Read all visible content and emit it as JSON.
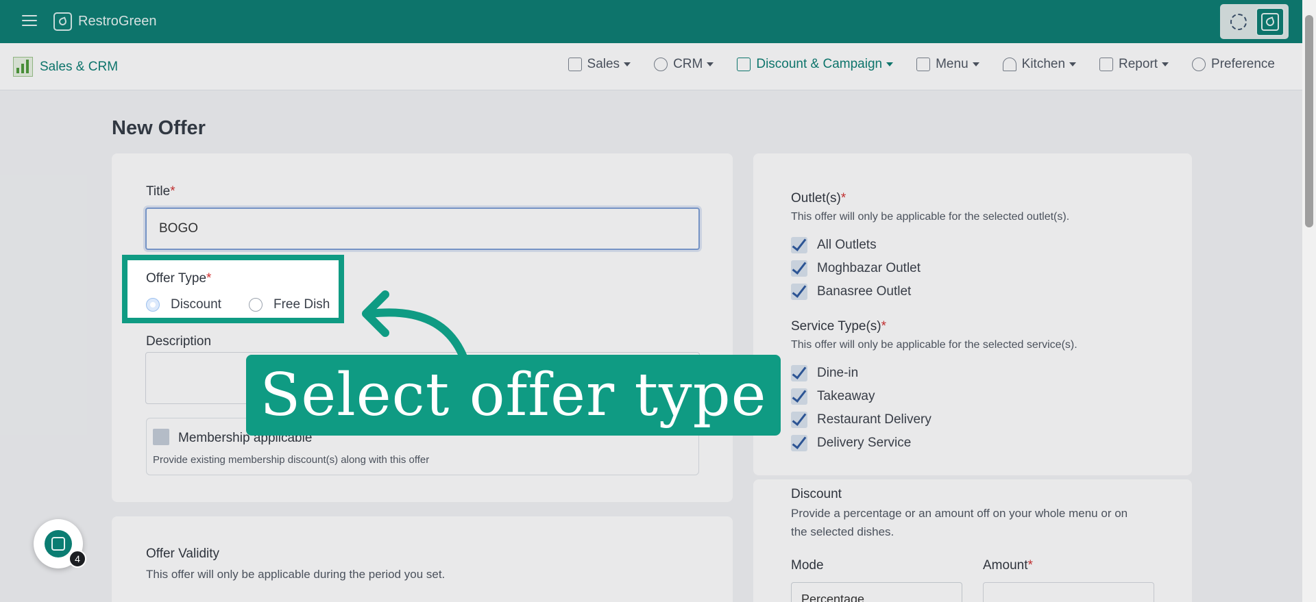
{
  "app": {
    "name": "RestroGreen"
  },
  "module": {
    "name": "Sales & CRM"
  },
  "nav": [
    {
      "label": "Sales",
      "icon": "register-icon",
      "active": false
    },
    {
      "label": "CRM",
      "icon": "users-icon",
      "active": false
    },
    {
      "label": "Discount & Campaign",
      "icon": "megaphone-icon",
      "active": true
    },
    {
      "label": "Menu",
      "icon": "menu-list-icon",
      "active": false
    },
    {
      "label": "Kitchen",
      "icon": "chef-icon",
      "active": false
    },
    {
      "label": "Report",
      "icon": "report-icon",
      "active": false
    },
    {
      "label": "Preference",
      "icon": "gear-icon",
      "active": false
    }
  ],
  "page": {
    "title": "New Offer"
  },
  "form": {
    "title_label": "Title",
    "required_mark": "*",
    "title_value": "BOGO",
    "offer_type_label": "Offer Type",
    "offer_types": [
      "Discount",
      "Free Dish"
    ],
    "selected_offer_type": "Discount",
    "description_label": "Description",
    "membership_label": "Membership applicable",
    "membership_help": "Provide existing membership discount(s) along with this offer",
    "validity_label": "Offer Validity",
    "validity_help": "This offer will only be applicable during the period you set."
  },
  "outlets": {
    "label": "Outlet(s)",
    "help": "This offer will only be applicable for the selected outlet(s).",
    "items": [
      "All Outlets",
      "Moghbazar Outlet",
      "Banasree Outlet"
    ]
  },
  "services": {
    "label": "Service Type(s)",
    "help": "This offer will only be applicable for the selected service(s).",
    "items": [
      "Dine-in",
      "Takeaway",
      "Restaurant Delivery",
      "Delivery Service"
    ]
  },
  "discount": {
    "label": "Discount",
    "help_line1": "Provide a percentage or an amount off on your whole menu or on",
    "help_line2": "the selected dishes.",
    "mode_label": "Mode",
    "mode_value": "Percentage",
    "amount_label": "Amount"
  },
  "tutorial": {
    "callout": "Select offer type"
  },
  "chat": {
    "badge": "4"
  },
  "colors": {
    "brand": "#0b7d72",
    "accent": "#0f9b83",
    "required": "#d12f2f"
  }
}
